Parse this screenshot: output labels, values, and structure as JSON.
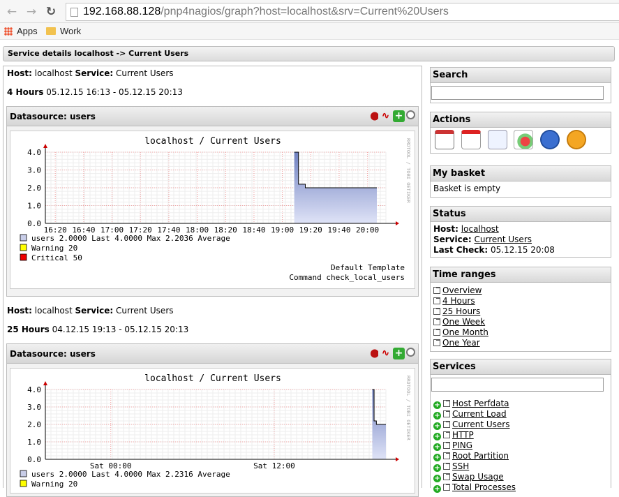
{
  "browser": {
    "url_host": "192.168.88.128",
    "url_rest": "/pnp4nagios/graph?host=localhost&srv=Current%20Users",
    "bookmarks": [
      {
        "label": "Apps"
      },
      {
        "label": "Work"
      }
    ]
  },
  "page": {
    "service_bar": "Service details localhost -> Current Users",
    "sections": [
      {
        "host_label": "Host:",
        "host": "localhost",
        "service_label": "Service:",
        "service": "Current Users",
        "range_label": "4 Hours",
        "range": "05.12.15 16:13 - 05.12.15 20:13",
        "datasource": "Datasource: users",
        "graph_title": "localhost / Current Users",
        "side_label": "RRDTOOL / TOBI OETIKER",
        "legend_users": "users              2.0000   Last   4.0000   Max   2.2036   Average",
        "legend_warning": "Warning  20",
        "legend_critical": "Critical 50",
        "template": "Default Template",
        "command": "Command check_local_users"
      },
      {
        "host_label": "Host:",
        "host": "localhost",
        "service_label": "Service:",
        "service": "Current Users",
        "range_label": "25 Hours",
        "range": "04.12.15 19:13 - 05.12.15 20:13",
        "datasource": "Datasource: users",
        "graph_title": "localhost / Current Users",
        "side_label": "RRDTOOL / TOBI OETIKER",
        "legend_users": "users              2.0000   Last   4.0000   Max   2.2316   Average",
        "legend_warning": "Warning  20"
      }
    ]
  },
  "sidebar": {
    "search_title": "Search",
    "actions_title": "Actions",
    "action_icons": [
      "calendar-icon",
      "pdf-icon",
      "xml-icon",
      "chart-icon",
      "info-icon",
      "help-icon"
    ],
    "basket_title": "My basket",
    "basket_text": "Basket is empty",
    "status_title": "Status",
    "status_host_label": "Host:",
    "status_host": "localhost",
    "status_service_label": "Service:",
    "status_service": "Current Users",
    "status_lastcheck_label": "Last Check:",
    "status_lastcheck": "05.12.15 20:08",
    "timeranges_title": "Time ranges",
    "timeranges": [
      "Overview",
      "4 Hours",
      "25 Hours",
      "One Week",
      "One Month",
      "One Year"
    ],
    "services_title": "Services",
    "services": [
      "Host Perfdata",
      "Current Load",
      "Current Users",
      "HTTP",
      "PING",
      "Root Partition",
      "SSH",
      "Swap Usage",
      "Total Processes"
    ]
  },
  "chart_data": [
    {
      "type": "area",
      "title": "localhost / Current Users",
      "x_ticks": [
        "16:20",
        "16:40",
        "17:00",
        "17:20",
        "17:40",
        "18:00",
        "18:20",
        "18:40",
        "19:00",
        "19:20",
        "19:40",
        "20:00"
      ],
      "y_ticks": [
        "0.0",
        "1.0",
        "2.0",
        "3.0",
        "4.0"
      ],
      "ylim": [
        0,
        4
      ],
      "series": [
        {
          "name": "users",
          "points": [
            [
              19.14,
              4.0
            ],
            [
              19.19,
              4.0
            ],
            [
              19.19,
              2.2
            ],
            [
              19.27,
              2.2
            ],
            [
              19.27,
              2.0
            ],
            [
              20.11,
              2.0
            ]
          ]
        }
      ],
      "colors": {
        "fill_top": "#8090c8",
        "fill_bottom": "#d8dcf4",
        "line": "#000000",
        "warning": "#ffff00",
        "critical": "#ff0000"
      }
    },
    {
      "type": "area",
      "title": "localhost / Current Users",
      "x_ticks": [
        "Sat 00:00",
        "Sat 12:00"
      ],
      "y_ticks": [
        "0.0",
        "1.0",
        "2.0",
        "3.0",
        "4.0"
      ],
      "ylim": [
        0,
        4
      ],
      "series": [
        {
          "name": "users",
          "points": [
            [
              19.2,
              4.0
            ],
            [
              19.33,
              4.0
            ],
            [
              19.33,
              2.2
            ],
            [
              19.5,
              2.2
            ],
            [
              19.5,
              2.0
            ],
            [
              20.2,
              2.0
            ]
          ]
        }
      ]
    }
  ]
}
